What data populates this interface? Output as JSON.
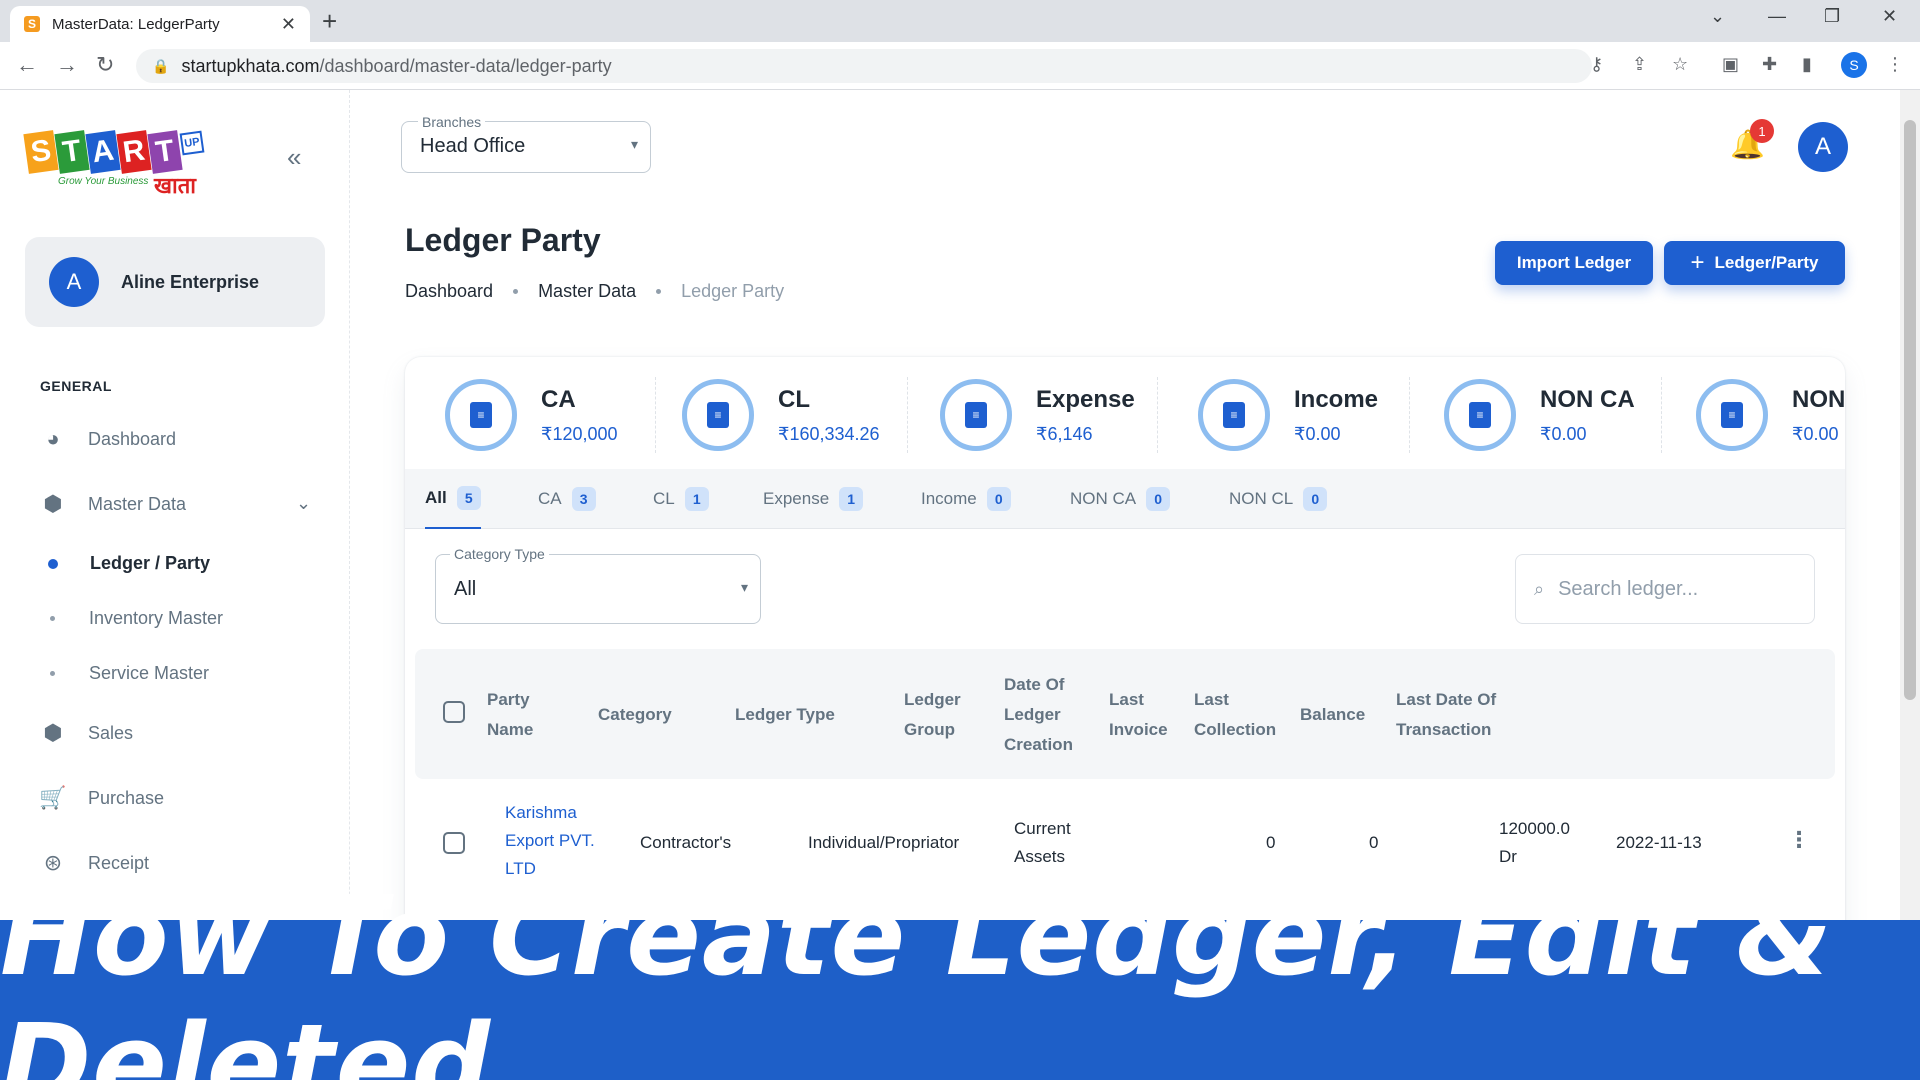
{
  "browser": {
    "tab_title": "MasterData: LedgerParty",
    "url_host": "startupkhata.com",
    "url_path": "/dashboard/master-data/ledger-party",
    "profile_initial": "S"
  },
  "sidebar": {
    "logo_letters": [
      "S",
      "T",
      "A",
      "R",
      "T"
    ],
    "logo_tagline": "Grow Your Business",
    "logo_hindi": "खाता",
    "logo_up": "UP",
    "account_initial": "A",
    "account_name": "Aline Enterprise",
    "section_title": "GENERAL",
    "items": [
      {
        "label": "Dashboard",
        "icon": "pie-chart-icon"
      },
      {
        "label": "Master Data",
        "icon": "chart-box-icon"
      },
      {
        "label": "Ledger / Party",
        "icon": "dot-active"
      },
      {
        "label": "Inventory Master",
        "icon": "dot"
      },
      {
        "label": "Service Master",
        "icon": "dot"
      },
      {
        "label": "Sales",
        "icon": "chart-box-icon"
      },
      {
        "label": "Purchase",
        "icon": "cart-icon"
      },
      {
        "label": "Receipt",
        "icon": "money-icon"
      }
    ]
  },
  "header": {
    "branches_label": "Branches",
    "branches_value": "Head Office",
    "notification_count": "1",
    "user_initial": "A"
  },
  "page": {
    "title": "Ledger Party",
    "breadcrumb": [
      "Dashboard",
      "Master Data",
      "Ledger Party"
    ],
    "import_button": "Import Ledger",
    "add_button": "Ledger/Party"
  },
  "stats": [
    {
      "key": "CA",
      "value": "₹120,000"
    },
    {
      "key": "CL",
      "value": "₹160,334.26"
    },
    {
      "key": "Expense",
      "value": "₹6,146"
    },
    {
      "key": "Income",
      "value": "₹0.00"
    },
    {
      "key": "NON CA",
      "value": "₹0.00"
    },
    {
      "key": "NON",
      "value": "₹0.00"
    }
  ],
  "filter_tabs": [
    {
      "label": "All",
      "count": "5"
    },
    {
      "label": "CA",
      "count": "3"
    },
    {
      "label": "CL",
      "count": "1"
    },
    {
      "label": "Expense",
      "count": "1"
    },
    {
      "label": "Income",
      "count": "0"
    },
    {
      "label": "NON CA",
      "count": "0"
    },
    {
      "label": "NON CL",
      "count": "0"
    }
  ],
  "filters": {
    "category_label": "Category Type",
    "category_value": "All",
    "search_placeholder": "Search ledger..."
  },
  "table": {
    "headers": [
      "Party Name",
      "Category",
      "Ledger Type",
      "Ledger Group",
      "Date Of Ledger Creation",
      "Last Invoice",
      "Last Collection",
      "Balance",
      "Last Date Of Transaction"
    ],
    "rows": [
      {
        "party_name": "Karishma Export PVT. LTD",
        "category": "Contractor's",
        "ledger_type": "Individual/Propriator",
        "ledger_group": "Current Assets",
        "date_created": "",
        "last_invoice": "0",
        "last_collection": "0",
        "balance": "120000.0 Dr",
        "last_date": "2022-11-13"
      }
    ]
  },
  "banner": {
    "text": "How To Create Ledger, Edit & Deleted"
  },
  "colors": {
    "primary": "#1e5fd0",
    "banner": "#1e5fc8",
    "ring": "#8dbdf0"
  }
}
